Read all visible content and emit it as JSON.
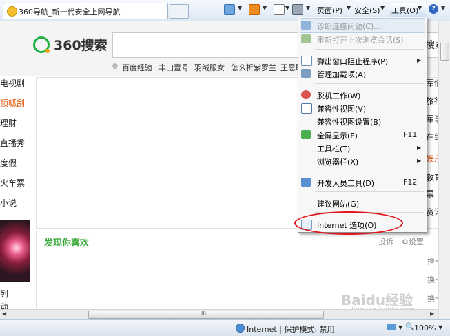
{
  "browser": {
    "tab_title": "360导航_新一代安全上网导航",
    "toolbar": {
      "page_label": "页面(P)",
      "safety_label": "安全(S)",
      "tools_label": "工具(O)"
    },
    "status": {
      "zone_text": "Internet | 保护模式: 禁用",
      "zoom": "100%"
    }
  },
  "page": {
    "logo_text": "360搜索",
    "search_button": "搜索",
    "quick_links": [
      "百度经验",
      "丰山壹号",
      "羽绒服女",
      "怎么折紫罗兰",
      "王思聪"
    ],
    "left_nav": [
      "电视剧",
      "顶呱刮",
      "理财",
      "直播秀",
      "度假",
      "火车票",
      "小说",
      "列",
      "动"
    ],
    "right_nav": [
      "军情",
      "旅行",
      "军事",
      "在线",
      "娱乐",
      "教育",
      "票",
      "资讯"
    ],
    "discover_title": "发现你喜欢",
    "discover_actions": {
      "report": "投诉",
      "settings": "设置"
    },
    "refresh_labels": [
      "换一",
      "换一",
      "换一"
    ],
    "watermark": "Baidu经验",
    "watermark_sub": "jingyan.baidu.com",
    "hscroll_grip": "III"
  },
  "menu": {
    "items": [
      {
        "label": "诊断连接问题(C)...",
        "disabled": true,
        "icon": "network-diagnose-icon"
      },
      {
        "label": "重新打开上次浏览会话(S)",
        "disabled": true,
        "icon": "reopen-session-icon"
      },
      {
        "label": "弹出窗口阻止程序(P)",
        "submenu": true,
        "icon": "popup-blocker-icon"
      },
      {
        "label": "管理加载项(A)",
        "icon": "addons-icon"
      },
      {
        "label": "脱机工作(W)",
        "icon": "offline-icon"
      },
      {
        "label": "兼容性视图(V)",
        "icon": "compat-view-icon"
      },
      {
        "label": "兼容性视图设置(B)"
      },
      {
        "label": "全屏显示(F)",
        "shortcut": "F11",
        "icon": "fullscreen-icon"
      },
      {
        "label": "工具栏(T)",
        "submenu": true
      },
      {
        "label": "浏览器栏(X)",
        "submenu": true
      },
      {
        "label": "开发人员工具(D)",
        "shortcut": "F12",
        "icon": "dev-tools-icon"
      },
      {
        "label": "建议网站(G)"
      },
      {
        "label": "Internet 选项(O)",
        "icon": "internet-options-icon"
      }
    ]
  },
  "colors": {
    "highlight_ellipse": "#e0141a",
    "logo_green": "#1fb141",
    "discover_green": "#3aa83a"
  }
}
